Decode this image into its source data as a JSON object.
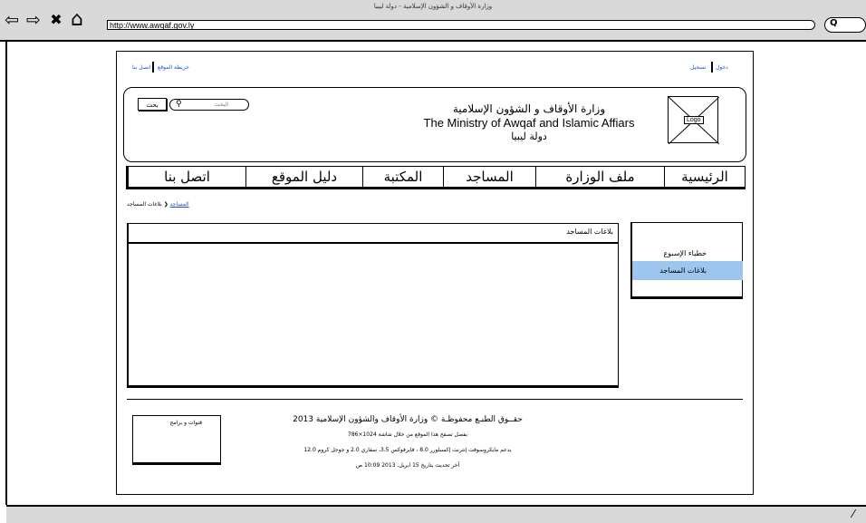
{
  "browser": {
    "window_title": "وزارة الأوقاف و الشؤون الإسلامية - دولة ليبيا",
    "url": "http://www.awqaf.gov.ly",
    "back_icon": "⇦",
    "forward_icon": "⇨",
    "stop_icon": "✖",
    "home_icon": "⌂",
    "search_icon": "Q"
  },
  "topbar": {
    "right_links": [
      "دخول",
      "تسجيل"
    ],
    "left_links": [
      "اتصل بنا",
      "خريطة الموقع"
    ]
  },
  "header": {
    "title_ar": "وزارة الأوقاف و الشؤون الإسلامية",
    "title_en": "The Ministry of Awqaf and Islamic Affiars",
    "country": "دولة ليبيا",
    "logo_label": "Logo",
    "search_placeholder": "البحث",
    "search_button": "بحث"
  },
  "nav": [
    {
      "label": "الرئيسية"
    },
    {
      "label": "ملف الوزارة"
    },
    {
      "label": "المساجد"
    },
    {
      "label": "المكتبة"
    },
    {
      "label": "دليل الموقع"
    },
    {
      "label": "اتصل بنا"
    }
  ],
  "breadcrumb": {
    "current": "بلاغات المساجد",
    "separator": "❮",
    "parent": "المساجد"
  },
  "sidebar": {
    "items": [
      {
        "label": "خطباء الإسبوع",
        "selected": false
      },
      {
        "label": "بلاغات المساجد",
        "selected": true
      }
    ],
    "selected_color": "#9ec5ee"
  },
  "content": {
    "title": "بلاغات المساجد"
  },
  "footer": {
    "channels": "قنوات و برامج",
    "copyright": "حقــوق الطبـع محفوظـة © وزارة الأوقاف والشؤون الإسلامية 2013",
    "resolution": "يفضل تصفح هذا الموقع من خلال شاشة 1024×786",
    "browsers": "يدعم مايكروسوفت إنترنت إكسبلورر 8.0 ، فايرفوكس 3.5، سفاري 2.0 و جوجل كروم 12.0",
    "updated": "آخر تحديث بتاريخ 15 ابريل, 2013 10:09 ص"
  }
}
